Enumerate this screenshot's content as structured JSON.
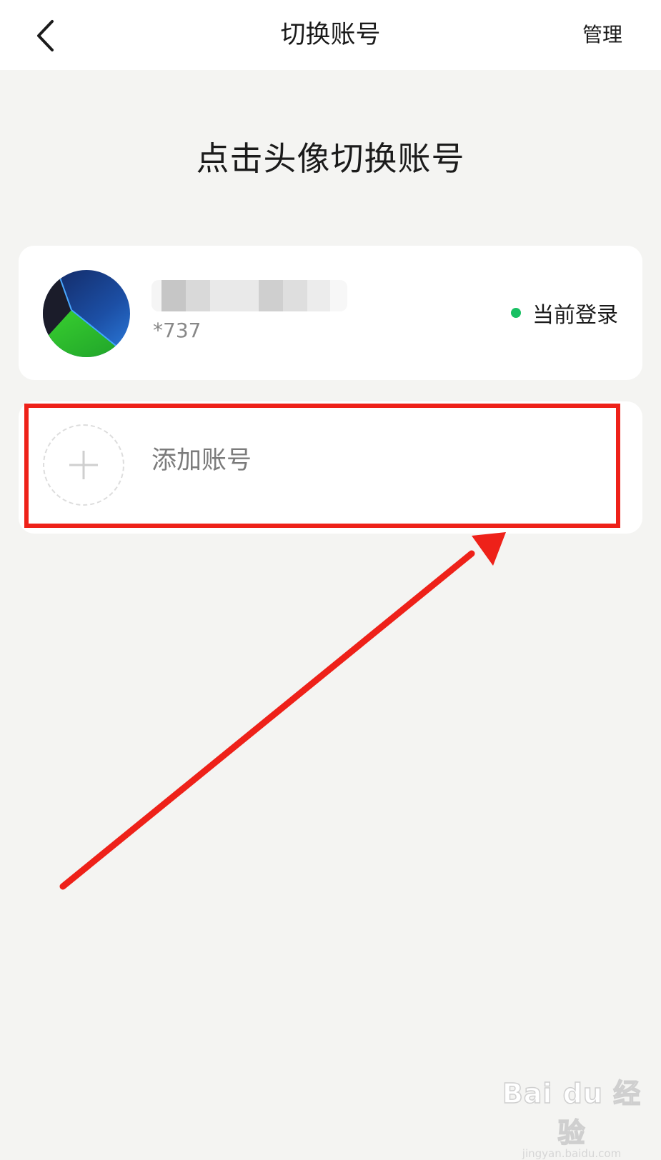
{
  "nav": {
    "title": "切换账号",
    "manage_label": "管理"
  },
  "hint": "点击头像切换账号",
  "accounts": [
    {
      "name": "",
      "masked_id": "*737",
      "status_label": "当前登录",
      "status_color": "#19c063"
    }
  ],
  "add_account": {
    "label": "添加账号"
  },
  "annotation": {
    "highlight_color": "#ee2119"
  },
  "watermark": {
    "logo": "Bai du 经验",
    "url": "jingyan.baidu.com"
  }
}
